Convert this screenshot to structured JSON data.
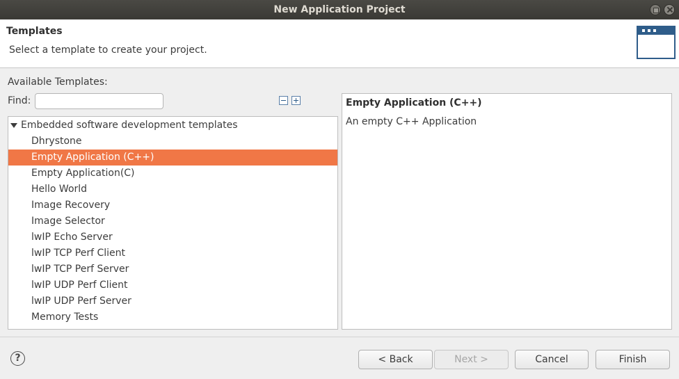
{
  "window": {
    "title": "New Application Project"
  },
  "header": {
    "title": "Templates",
    "description": "Select a template to create your project."
  },
  "templates": {
    "available_label": "Available Templates:",
    "find_label": "Find:",
    "find_value": "",
    "tree_root": "Embedded software development templates",
    "items": [
      "Dhrystone",
      "Empty Application (C++)",
      "Empty Application(C)",
      "Hello World",
      "Image Recovery",
      "Image Selector",
      "lwIP Echo Server",
      "lwIP TCP Perf Client",
      "lwIP TCP Perf Server",
      "lwIP UDP Perf Client",
      "lwIP UDP Perf Server",
      "Memory Tests"
    ],
    "selected": "Empty Application (C++)"
  },
  "description_panel": {
    "title": "Empty Application (C++)",
    "text": "An empty C++ Application"
  },
  "footer": {
    "help_label": "?",
    "back_label": "< Back",
    "next_label": "Next >",
    "cancel_label": "Cancel",
    "finish_label": "Finish"
  },
  "colors": {
    "selection": "#f07746",
    "titlebar": "#3f3e3a"
  }
}
